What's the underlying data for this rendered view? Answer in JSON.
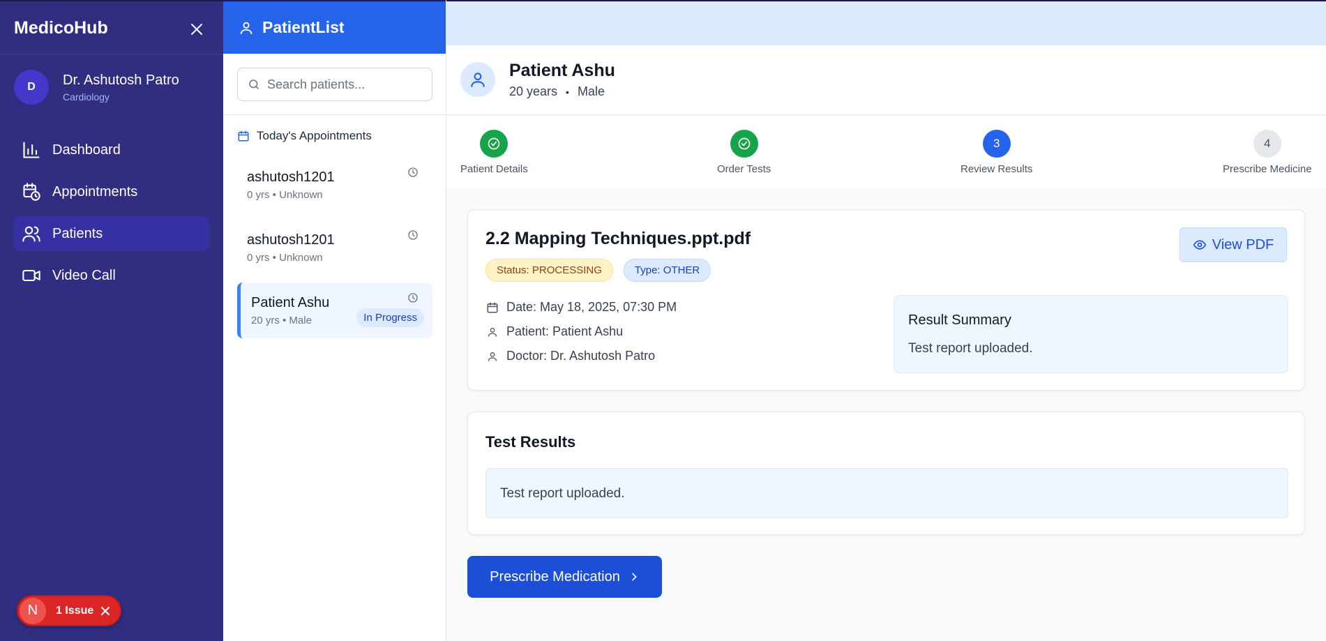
{
  "sidebar": {
    "brand": "MedicoHub",
    "close_icon": "close-icon",
    "doctor": {
      "initial": "D",
      "name": "Dr. Ashutosh Patro",
      "specialty": "Cardiology"
    },
    "nav": [
      {
        "label": "Dashboard",
        "icon": "bar-chart-icon"
      },
      {
        "label": "Appointments",
        "icon": "calendar-clock-icon"
      },
      {
        "label": "Patients",
        "icon": "users-icon",
        "active": true
      },
      {
        "label": "Video Call",
        "icon": "video-icon"
      }
    ],
    "issue": {
      "logo": "N",
      "label": "1 Issue"
    }
  },
  "patient_list": {
    "title": "PatientList",
    "search_placeholder": "Search patients...",
    "section_title": "Today's Appointments",
    "appointments": [
      {
        "name": "ashutosh1201",
        "meta": "0 yrs • Unknown"
      },
      {
        "name": "ashutosh1201",
        "meta": "0 yrs • Unknown"
      },
      {
        "name": "Patient Ashu",
        "meta": "20 yrs • Male",
        "status": "In Progress",
        "selected": true
      }
    ]
  },
  "patient": {
    "name": "Patient Ashu",
    "age": "20 years",
    "separator": "•",
    "gender": "Male"
  },
  "steps": [
    {
      "label": "Patient Details",
      "state": "done"
    },
    {
      "label": "Order Tests",
      "state": "done"
    },
    {
      "label": "Review Results",
      "state": "current",
      "number": "3"
    },
    {
      "label": "Prescribe Medicine",
      "state": "todo",
      "number": "4"
    }
  ],
  "document": {
    "title": "2.2 Mapping Techniques.ppt.pdf",
    "status_badge": "Status: PROCESSING",
    "type_badge": "Type: OTHER",
    "view_pdf_label": "View PDF",
    "date": "Date: May 18, 2025, 07:30 PM",
    "patient": "Patient: Patient Ashu",
    "doctor": "Doctor: Dr. Ashutosh Patro",
    "summary_title": "Result Summary",
    "summary_text": "Test report uploaded."
  },
  "test_results": {
    "title": "Test Results",
    "text": "Test report uploaded."
  },
  "actions": {
    "prescribe_label": "Prescribe Medication"
  },
  "colors": {
    "sidebar_bg": "#312e81",
    "primary": "#2563eb",
    "success": "#16a34a",
    "issue_red": "#dc2626"
  }
}
